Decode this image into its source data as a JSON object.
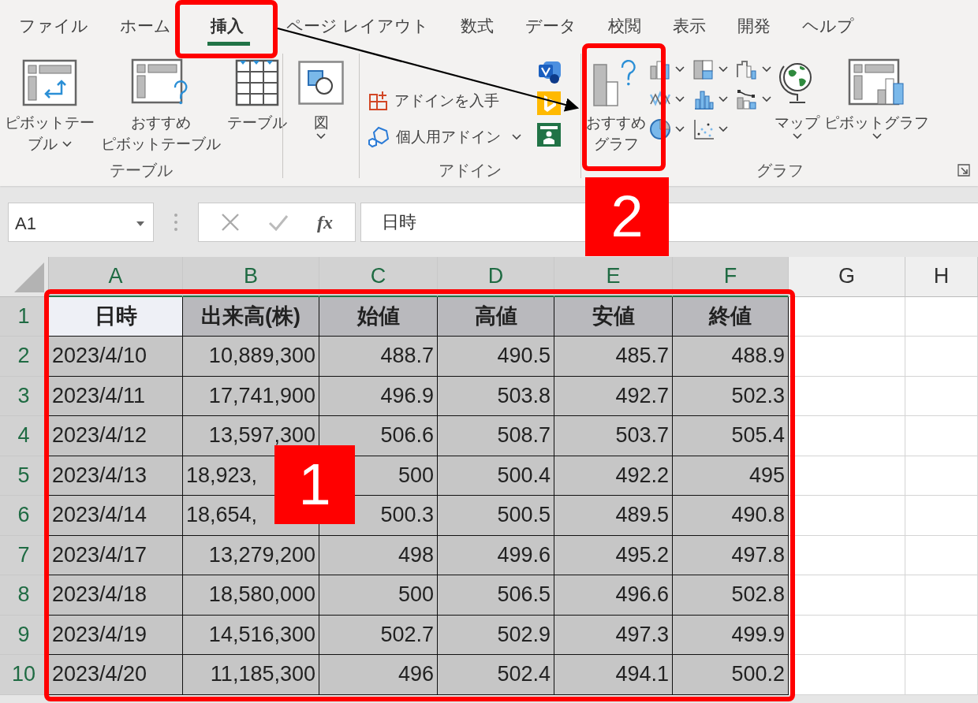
{
  "ribbon_tabs": [
    {
      "label": "ファイル",
      "selected": false
    },
    {
      "label": "ホーム",
      "selected": false
    },
    {
      "label": "挿入",
      "selected": true
    },
    {
      "label": "ページ レイアウト",
      "selected": false
    },
    {
      "label": "数式",
      "selected": false
    },
    {
      "label": "データ",
      "selected": false
    },
    {
      "label": "校閲",
      "selected": false
    },
    {
      "label": "表示",
      "selected": false
    },
    {
      "label": "開発",
      "selected": false
    },
    {
      "label": "ヘルプ",
      "selected": false
    }
  ],
  "ribbon": {
    "table_group": {
      "label": "テーブル",
      "buttons": [
        {
          "kind": "pivot",
          "lines": [
            "ピボットテー",
            "ブル"
          ],
          "dropdown": true
        },
        {
          "kind": "recommended-pivot",
          "lines": [
            "おすすめ",
            "ピボットテーブル"
          ],
          "dropdown": false
        },
        {
          "kind": "table",
          "lines": [
            "テーブル"
          ],
          "dropdown": false
        }
      ]
    },
    "illustrations_group": {
      "buttons": [
        {
          "kind": "shapes",
          "lines": [
            "図"
          ],
          "dropdown": true
        }
      ]
    },
    "addins_group": {
      "label": "アドイン",
      "buttons": [
        {
          "kind": "get-addins",
          "label": "アドインを入手",
          "dropdown": false
        },
        {
          "kind": "my-addins",
          "label": "個人用アドイン",
          "dropdown": true
        }
      ]
    },
    "chart_group": {
      "label": "グラフ",
      "buttons": [
        {
          "kind": "recommended-chart",
          "lines": [
            "おすすめ",
            "グラフ"
          ],
          "dropdown": false
        },
        {
          "kind": "map",
          "lines": [
            "マップ"
          ],
          "dropdown": true
        },
        {
          "kind": "pivot-chart",
          "lines": [
            "ピボットグラフ"
          ],
          "dropdown": true
        }
      ]
    }
  },
  "formula_bar": {
    "name_box": "A1",
    "function_label": "fx",
    "formula": "日時"
  },
  "sheet": {
    "columns": [
      {
        "label": "A",
        "selected": true
      },
      {
        "label": "B",
        "selected": true
      },
      {
        "label": "C",
        "selected": true
      },
      {
        "label": "D",
        "selected": true
      },
      {
        "label": "E",
        "selected": true
      },
      {
        "label": "F",
        "selected": true
      },
      {
        "label": "G",
        "selected": false
      },
      {
        "label": "H",
        "selected": false
      }
    ],
    "header_row": {
      "number": "1",
      "selected": true,
      "cells": [
        {
          "text": "日時",
          "active": true
        },
        {
          "text": "出来高(株)",
          "active": false
        },
        {
          "text": "始値",
          "active": false
        },
        {
          "text": "高値",
          "active": false
        },
        {
          "text": "安値",
          "active": false
        },
        {
          "text": "終値",
          "active": false
        }
      ]
    },
    "rows": [
      {
        "number": "2",
        "selected": true,
        "cells": [
          "2023/4/10",
          "10,889,300",
          "488.7",
          "490.5",
          "485.7",
          "488.9"
        ]
      },
      {
        "number": "3",
        "selected": true,
        "cells": [
          "2023/4/11",
          "17,741,900",
          "496.9",
          "503.8",
          "492.7",
          "502.3"
        ]
      },
      {
        "number": "4",
        "selected": true,
        "cells": [
          "2023/4/12",
          "13,597,300",
          "506.6",
          "508.7",
          "503.7",
          "505.4"
        ]
      },
      {
        "number": "5",
        "selected": true,
        "cells": [
          "2023/4/13",
          {
            "text": "18,923,",
            "covered": true
          },
          "500",
          "500.4",
          "492.2",
          "495"
        ]
      },
      {
        "number": "6",
        "selected": true,
        "cells": [
          "2023/4/14",
          {
            "text": "18,654,",
            "covered": true
          },
          "500.3",
          "500.5",
          "489.5",
          "490.8"
        ]
      },
      {
        "number": "7",
        "selected": true,
        "cells": [
          "2023/4/17",
          "13,279,200",
          "498",
          "499.6",
          "495.2",
          "497.8"
        ]
      },
      {
        "number": "8",
        "selected": true,
        "cells": [
          "2023/4/18",
          "18,580,000",
          "500",
          "506.5",
          "496.6",
          "502.8"
        ]
      },
      {
        "number": "9",
        "selected": true,
        "cells": [
          "2023/4/19",
          "14,516,300",
          "502.7",
          "502.9",
          "497.3",
          "499.9"
        ]
      },
      {
        "number": "10",
        "selected": true,
        "cells": [
          "2023/4/20",
          "11,185,300",
          "496",
          "502.4",
          "494.1",
          "500.2"
        ]
      }
    ]
  },
  "callouts": [
    {
      "label": "1"
    },
    {
      "label": "2"
    }
  ]
}
